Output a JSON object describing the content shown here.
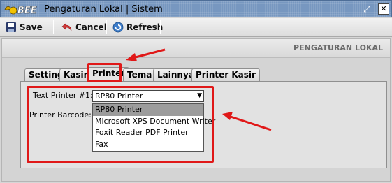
{
  "window": {
    "logo_text": "BEE",
    "title": "Pengaturan Lokal | Sistem"
  },
  "toolbar": {
    "save_label": "Save",
    "cancel_label": "Cancel",
    "refresh_label": "Refresh"
  },
  "section_title": "PENGATURAN LOKAL",
  "tabs": [
    {
      "label": "Setting",
      "active": false
    },
    {
      "label": "Kasir",
      "active": false
    },
    {
      "label": "Printer",
      "active": true
    },
    {
      "label": "Tema",
      "active": false
    },
    {
      "label": "Lainnya",
      "active": false
    },
    {
      "label": "Printer Kasir",
      "active": false
    }
  ],
  "printer_tab": {
    "text_printer_label": "Text Printer #1:",
    "text_printer_value": "RP80 Printer",
    "printer_barcode_label": "Printer Barcode:",
    "options": [
      "RP80 Printer",
      "Microsoft XPS Document Writer",
      "Foxit Reader PDF Printer",
      "Fax"
    ],
    "selected_option_index": 0
  },
  "colors": {
    "annotation_red": "#e01818",
    "titlebar_blue": "#7797c0",
    "selected_option_bg": "#9c9c9c"
  }
}
